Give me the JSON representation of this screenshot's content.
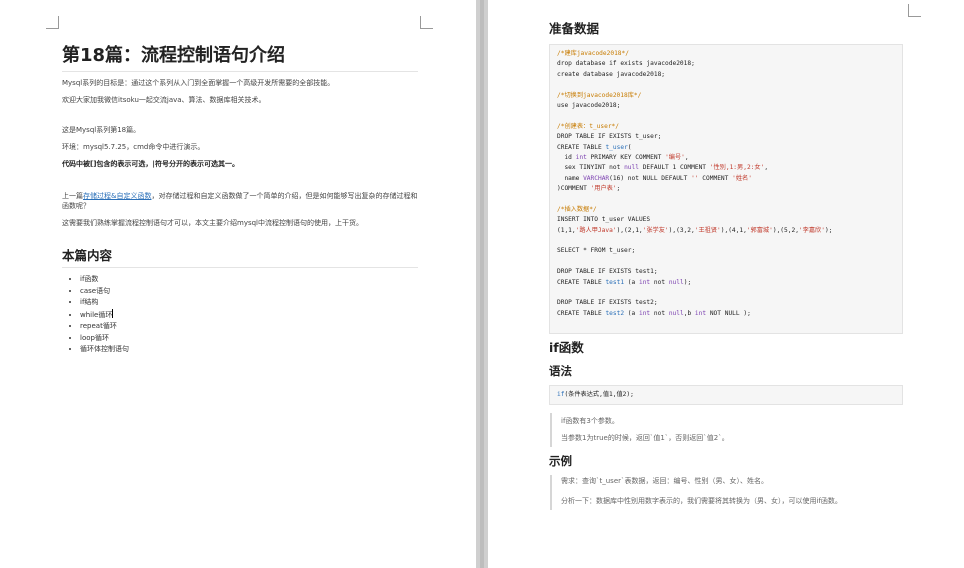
{
  "left_page": {
    "title": "第18篇：流程控制语句介绍",
    "intro1": "Mysql系列的目标是：通过这个系列从入门到全面掌握一个高级开发所需要的全部技能。",
    "intro2": "欢迎大家加我微信itsoku一起交流java、算法、数据库相关技术。",
    "series_line": "这是Mysql系列第18篇。",
    "env_line": "环境：mysql5.7.25，cmd命令中进行演示。",
    "bold_note": "代码中被[]包含的表示可选，|符号分开的表示可选其一。",
    "prev_prefix": "上一篇",
    "prev_link": "存储过程&自定义函数",
    "prev_suffix": "，对存储过程和自定义函数做了一个简单的介绍，但是如何能够写出复杂的存储过程和函数呢？",
    "need_line": "这需要我们熟练掌握流程控制语句才可以，本文主要介绍mysql中流程控制语句的使用，上干货。",
    "toc_title": "本篇内容",
    "toc": [
      "if函数",
      "case语句",
      "if结构",
      "while循环",
      "repeat循环",
      "loop循环",
      "循环体控制语句"
    ]
  },
  "right_page": {
    "prep_title": "准备数据",
    "code_lines": [
      [
        {
          "t": "/*建库javacode2018*/",
          "c": "comment"
        }
      ],
      [
        {
          "t": "drop database if exists javacode2018;",
          "c": "kw"
        }
      ],
      [
        {
          "t": "create database javacode2018;",
          "c": "kw"
        }
      ],
      [
        {
          "t": "",
          "c": "kw"
        }
      ],
      [
        {
          "t": "/*切换到javacode2018库*/",
          "c": "comment"
        }
      ],
      [
        {
          "t": "use javacode2018;",
          "c": "kw"
        }
      ],
      [
        {
          "t": "",
          "c": "kw"
        }
      ],
      [
        {
          "t": "/*创建表：t_user*/",
          "c": "comment"
        }
      ],
      [
        {
          "t": "DROP TABLE IF EXISTS t_user;",
          "c": "kw"
        }
      ],
      [
        {
          "t": "CREATE TABLE ",
          "c": "kw"
        },
        {
          "t": "t_user",
          "c": "fn"
        },
        {
          "t": "(",
          "c": "kw"
        }
      ],
      [
        {
          "t": "  id ",
          "c": "kw"
        },
        {
          "t": "int",
          "c": "type"
        },
        {
          "t": " PRIMARY KEY COMMENT ",
          "c": "kw"
        },
        {
          "t": "'编号'",
          "c": "str"
        },
        {
          "t": ",",
          "c": "kw"
        }
      ],
      [
        {
          "t": "  sex TINYINT not ",
          "c": "kw"
        },
        {
          "t": "null",
          "c": "type"
        },
        {
          "t": " DEFAULT 1 COMMENT ",
          "c": "kw"
        },
        {
          "t": "'性别,1:男,2:女'",
          "c": "str"
        },
        {
          "t": ",",
          "c": "kw"
        }
      ],
      [
        {
          "t": "  name ",
          "c": "kw"
        },
        {
          "t": "VARCHAR",
          "c": "type"
        },
        {
          "t": "(16) not NULL DEFAULT ",
          "c": "kw"
        },
        {
          "t": "''",
          "c": "str"
        },
        {
          "t": " COMMENT ",
          "c": "kw"
        },
        {
          "t": "'姓名'",
          "c": "str"
        }
      ],
      [
        {
          "t": ")COMMENT ",
          "c": "kw"
        },
        {
          "t": "'用户表'",
          "c": "str"
        },
        {
          "t": ";",
          "c": "kw"
        }
      ],
      [
        {
          "t": "",
          "c": "kw"
        }
      ],
      [
        {
          "t": "/*插入数据*/",
          "c": "comment"
        }
      ],
      [
        {
          "t": "INSERT INTO t_user VALUES",
          "c": "kw"
        }
      ],
      [
        {
          "t": "(1,1,",
          "c": "kw"
        },
        {
          "t": "'路人甲Java'",
          "c": "str"
        },
        {
          "t": "),(2,1,",
          "c": "kw"
        },
        {
          "t": "'张学友'",
          "c": "str"
        },
        {
          "t": "),(3,2,",
          "c": "kw"
        },
        {
          "t": "'王祖贤'",
          "c": "str"
        },
        {
          "t": "),(4,1,",
          "c": "kw"
        },
        {
          "t": "'郭富城'",
          "c": "str"
        },
        {
          "t": "),(5,2,",
          "c": "kw"
        },
        {
          "t": "'李嘉欣'",
          "c": "str"
        },
        {
          "t": ");",
          "c": "kw"
        }
      ],
      [
        {
          "t": "",
          "c": "kw"
        }
      ],
      [
        {
          "t": "SELECT * FROM t_user;",
          "c": "kw"
        }
      ],
      [
        {
          "t": "",
          "c": "kw"
        }
      ],
      [
        {
          "t": "DROP TABLE IF EXISTS test1;",
          "c": "kw"
        }
      ],
      [
        {
          "t": "CREATE TABLE ",
          "c": "kw"
        },
        {
          "t": "test1",
          "c": "fn"
        },
        {
          "t": " (a ",
          "c": "kw"
        },
        {
          "t": "int",
          "c": "type"
        },
        {
          "t": " not ",
          "c": "kw"
        },
        {
          "t": "null",
          "c": "type"
        },
        {
          "t": ");",
          "c": "kw"
        }
      ],
      [
        {
          "t": "",
          "c": "kw"
        }
      ],
      [
        {
          "t": "DROP TABLE IF EXISTS test2;",
          "c": "kw"
        }
      ],
      [
        {
          "t": "CREATE TABLE ",
          "c": "kw"
        },
        {
          "t": "test2",
          "c": "fn"
        },
        {
          "t": " (a ",
          "c": "kw"
        },
        {
          "t": "int",
          "c": "type"
        },
        {
          "t": " not ",
          "c": "kw"
        },
        {
          "t": "null",
          "c": "type"
        },
        {
          "t": ",b ",
          "c": "kw"
        },
        {
          "t": "int",
          "c": "type"
        },
        {
          "t": " NOT NULL );",
          "c": "kw"
        }
      ]
    ],
    "if_title": "if函数",
    "syntax_title": "语法",
    "syntax_code": [
      [
        {
          "t": "if",
          "c": "fn"
        },
        {
          "t": "(条件表达式,值1,值2);",
          "c": "kw"
        }
      ]
    ],
    "syntax_note1": "if函数有3个参数。",
    "syntax_note2": "当参数1为true的时候，返回`值1`，否则返回`值2`。",
    "example_title": "示例",
    "example_note1": "需求：查询`t_user`表数据，返回：编号、性别（男、女）、姓名。",
    "example_note2": "分析一下：数据库中性别用数字表示的，我们需要将其转换为（男、女），可以使用if函数。"
  }
}
